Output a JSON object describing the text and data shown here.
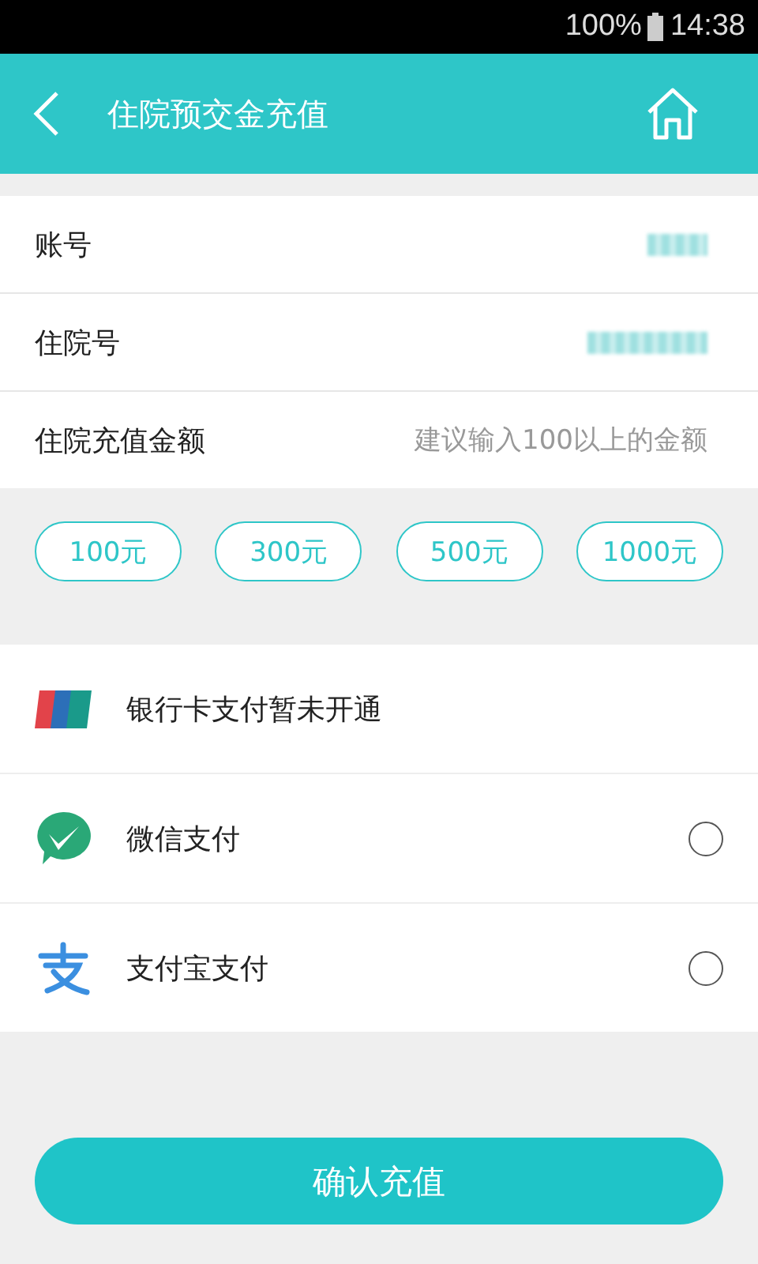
{
  "status_bar": {
    "battery": "100%",
    "time": "14:38"
  },
  "header": {
    "title": "住院预交金充值"
  },
  "fields": [
    {
      "label": "账号",
      "masked": true
    },
    {
      "label": "住院号",
      "masked": true
    },
    {
      "label": "住院充值金额",
      "placeholder": "建议输入100以上的金额"
    }
  ],
  "amounts": [
    {
      "label": "100元",
      "selected": false
    },
    {
      "label": "300元",
      "selected": false
    },
    {
      "label": "500元",
      "selected": false
    },
    {
      "label": "1000元",
      "selected": false
    }
  ],
  "payments": [
    {
      "kind": "unionpay",
      "label": "银行卡支付暂未开通",
      "disabled": true,
      "selected": false
    },
    {
      "kind": "wechat",
      "label": "微信支付",
      "disabled": false,
      "selected": false
    },
    {
      "kind": "alipay",
      "label": "支付宝支付",
      "disabled": false,
      "selected": false
    }
  ],
  "confirm_button": "确认充值"
}
